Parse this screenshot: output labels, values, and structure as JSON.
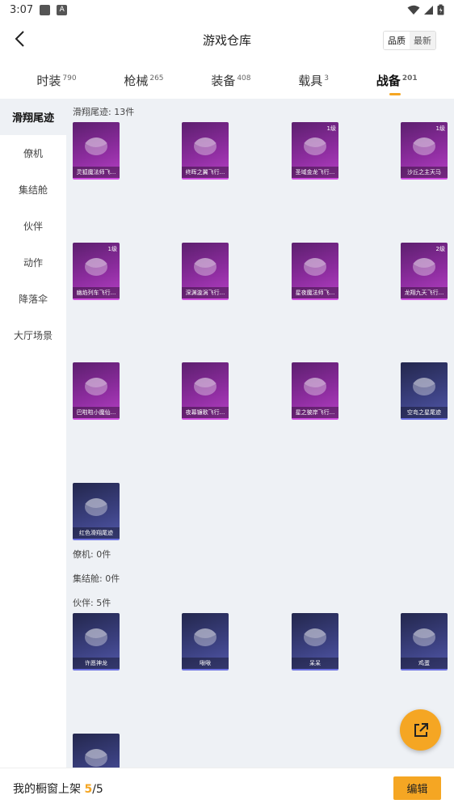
{
  "status_bar": {
    "time": "3:07",
    "icon1": "notification-square-icon",
    "icon2": "a-badge-icon",
    "icon2_text": "A"
  },
  "header": {
    "title": "游戏仓库",
    "sort_options": [
      "品质",
      "最新"
    ],
    "sort_active": "品质"
  },
  "tabs": [
    {
      "label": "时装",
      "count": "790"
    },
    {
      "label": "枪械",
      "count": "265"
    },
    {
      "label": "装备",
      "count": "408"
    },
    {
      "label": "载具",
      "count": "3"
    },
    {
      "label": "战备",
      "count": "201",
      "active": true
    }
  ],
  "sidebar": {
    "items": [
      "滑翔尾迹",
      "僚机",
      "集结舱",
      "伙伴",
      "动作",
      "降落伞",
      "大厅场景"
    ],
    "active": "滑翔尾迹"
  },
  "sections": [
    {
      "label": "滑翔尾迹: 13件"
    },
    {
      "label": "僚机: 0件"
    },
    {
      "label": "集结舱: 0件"
    },
    {
      "label": "伙伴: 5件"
    }
  ],
  "glide_items": [
    {
      "name": "灵狐魔法师飞...",
      "level": "",
      "tier": "purple"
    },
    {
      "name": "终晖之翼飞行...",
      "level": "",
      "tier": "purple"
    },
    {
      "name": "圣域金龙飞行...",
      "level": "1级",
      "tier": "purple"
    },
    {
      "name": "沙丘之主天马",
      "level": "1级",
      "tier": "purple"
    },
    {
      "name": "幽焰列车飞行...",
      "level": "1级",
      "tier": "purple"
    },
    {
      "name": "深渊漩涡飞行...",
      "level": "",
      "tier": "purple"
    },
    {
      "name": "星夜魔法师飞...",
      "level": "",
      "tier": "purple"
    },
    {
      "name": "龙翔九天飞行...",
      "level": "2级",
      "tier": "purple"
    },
    {
      "name": "巴啦啦小魔仙...",
      "level": "",
      "tier": "purple"
    },
    {
      "name": "夜幕镰歌飞行...",
      "level": "",
      "tier": "purple"
    },
    {
      "name": "星之彼岸飞行...",
      "level": "",
      "tier": "purple"
    },
    {
      "name": "空岛之星尾迹",
      "level": "",
      "tier": "blue"
    },
    {
      "name": "红色滑翔尾迹",
      "level": "",
      "tier": "blue"
    }
  ],
  "partner_items": [
    {
      "name": "许愿神龙",
      "tier": "blue"
    },
    {
      "name": "啾啾",
      "tier": "blue"
    },
    {
      "name": "呆呆",
      "tier": "blue"
    },
    {
      "name": "鸡蛋",
      "tier": "blue"
    },
    {
      "name": "",
      "tier": "blue"
    }
  ],
  "fab": {
    "icon": "share-external-icon"
  },
  "bottom_bar": {
    "label": "我的橱窗上架",
    "current": "5",
    "separator": "/",
    "total": "5",
    "edit_label": "编辑"
  },
  "colors": {
    "accent": "#f5a623",
    "purple_tier": "#8c2c9e",
    "blue_tier": "#3a3f7e",
    "content_bg": "#eef1f5"
  }
}
